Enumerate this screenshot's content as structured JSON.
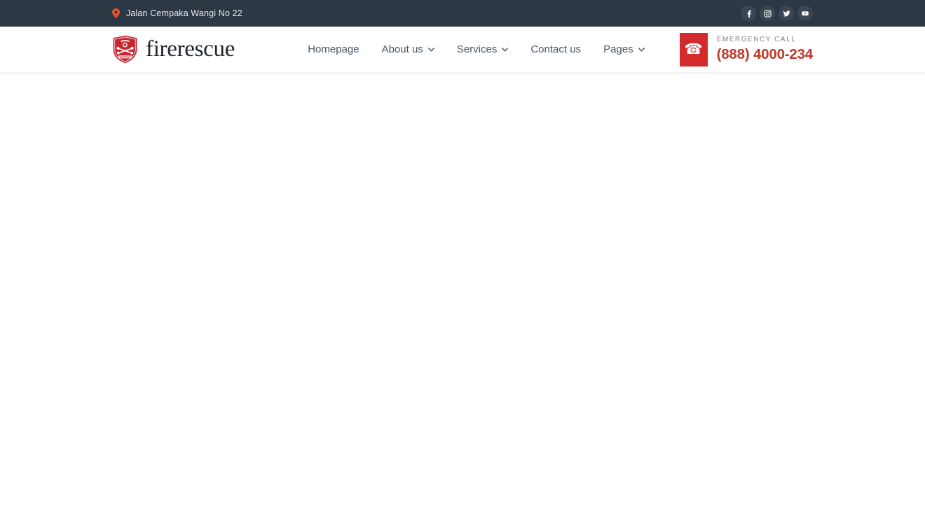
{
  "topbar": {
    "background_color": "#2c3945",
    "location_icon": "map-pin-icon",
    "address": "Jalan Cempaka Wangi No 22",
    "socials": [
      {
        "name": "facebook",
        "icon": "facebook-icon",
        "label": "f"
      },
      {
        "name": "instagram",
        "icon": "instagram-icon",
        "label": ""
      },
      {
        "name": "twitter",
        "icon": "twitter-icon",
        "label": ""
      },
      {
        "name": "youtube",
        "icon": "youtube-icon",
        "label": ""
      }
    ]
  },
  "header": {
    "brand": {
      "logo_icon": "fire-rescue-shield-badge-icon",
      "name": "firerescue",
      "logo_color": "#c62832",
      "name_color": "#20252a"
    },
    "nav": [
      {
        "label": "Homepage",
        "has_dropdown": false
      },
      {
        "label": "About us",
        "has_dropdown": true
      },
      {
        "label": "Services",
        "has_dropdown": true
      },
      {
        "label": "Contact us",
        "has_dropdown": false
      },
      {
        "label": "Pages",
        "has_dropdown": true
      }
    ],
    "emergency": {
      "icon": "telephone-icon",
      "icon_glyph": "☎",
      "label": "EMERGENCY CALL",
      "number": "(888) 4000-234",
      "box_color": "#d32b2b",
      "number_color": "#c0392b",
      "label_color": "#7e8287"
    }
  },
  "main": {
    "content": "",
    "background_color": "#ffffff"
  }
}
